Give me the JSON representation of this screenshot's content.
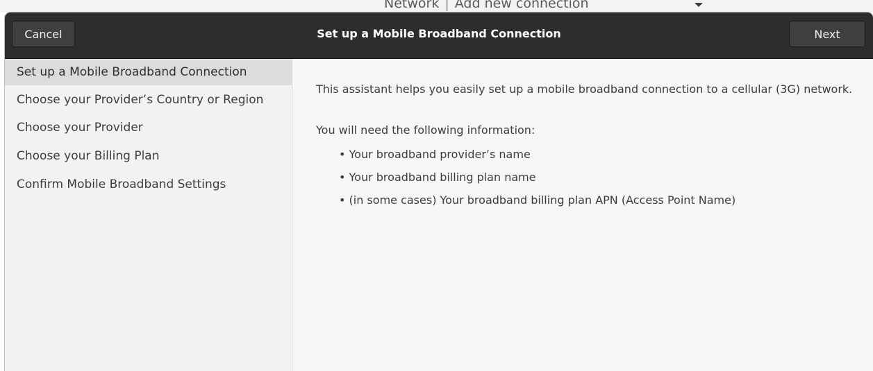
{
  "background_window": {
    "network_label": "Network",
    "add_connection_label": "Add new connection"
  },
  "headerbar": {
    "cancel_label": "Cancel",
    "title": "Set up a Mobile Broadband Connection",
    "next_label": "Next"
  },
  "steps": [
    {
      "label": "Set up a Mobile Broadband Connection",
      "active": true
    },
    {
      "label": "Choose your Provider’s Country or Region",
      "active": false
    },
    {
      "label": "Choose your Provider",
      "active": false
    },
    {
      "label": "Choose your Billing Plan",
      "active": false
    },
    {
      "label": "Confirm Mobile Broadband Settings",
      "active": false
    }
  ],
  "content": {
    "intro": "This assistant helps you easily set up a mobile broadband connection to a cellular (3G) network.",
    "need_heading": "You will need the following information:",
    "bullets": [
      "• Your broadband provider’s name",
      "• Your broadband billing plan name",
      "• (in some cases) Your broadband billing plan APN (Access Point Name)"
    ]
  },
  "colors": {
    "headerbar_bg": "#2d2d2d",
    "sidebar_bg": "#f2f2f2",
    "sidebar_active_bg": "#dcdcdc",
    "content_bg": "#f6f6f6"
  }
}
